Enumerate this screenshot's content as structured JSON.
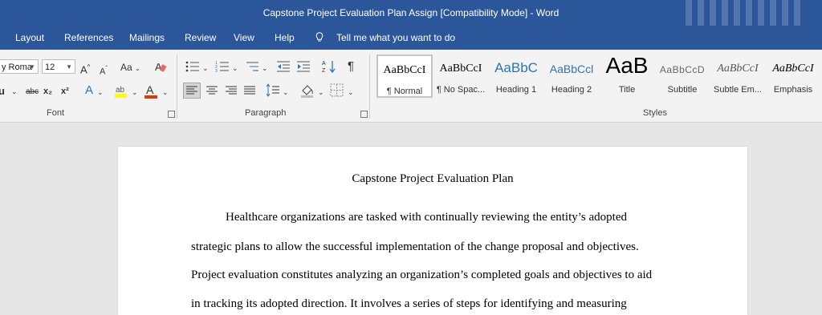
{
  "window": {
    "title": "Capstone Project Evaluation Plan Assign [Compatibility Mode]  -  Word"
  },
  "menu": {
    "layout": "Layout",
    "references": "References",
    "mailings": "Mailings",
    "review": "Review",
    "view": "View",
    "help": "Help",
    "tell_me": "Tell me what you want to do"
  },
  "ribbon": {
    "font": {
      "label": "Font",
      "font_name": "y Roma",
      "font_size": "12",
      "grow": "A",
      "shrink": "A",
      "change_case": "Aa",
      "strike": "abc",
      "subscript": "x₂",
      "superscript": "x²",
      "effects": "A",
      "font_color": "A"
    },
    "paragraph": {
      "label": "Paragraph",
      "pilcrow": "¶"
    },
    "styles": {
      "label": "Styles",
      "items": [
        {
          "sample": "AaBbCcI",
          "name": "¶ Normal"
        },
        {
          "sample": "AaBbCcI",
          "name": "¶ No Spac..."
        },
        {
          "sample": "AaBbC",
          "name": "Heading 1"
        },
        {
          "sample": "AaBbCcl",
          "name": "Heading 2"
        },
        {
          "sample": "AaB",
          "name": "Title"
        },
        {
          "sample": "AaBbCcD",
          "name": "Subtitle"
        },
        {
          "sample": "AaBbCcI",
          "name": "Subtle Em..."
        },
        {
          "sample": "AaBbCcI",
          "name": "Emphasis"
        }
      ]
    }
  },
  "colors": {
    "word_blue": "#2b579a",
    "highlight": "#ffff00",
    "font_color": "#d83b01",
    "heading_blue": "#2e74b5"
  },
  "document": {
    "title": "Capstone Project Evaluation Plan",
    "lines": [
      "Healthcare organizations are tasked with continually reviewing the entity’s adopted",
      "strategic plans to allow the successful implementation of the change proposal and objectives.",
      "Project evaluation constitutes analyzing an organization’s completed goals and objectives to aid",
      "in tracking its adopted direction. It involves a series of steps for identifying and measuring"
    ]
  }
}
